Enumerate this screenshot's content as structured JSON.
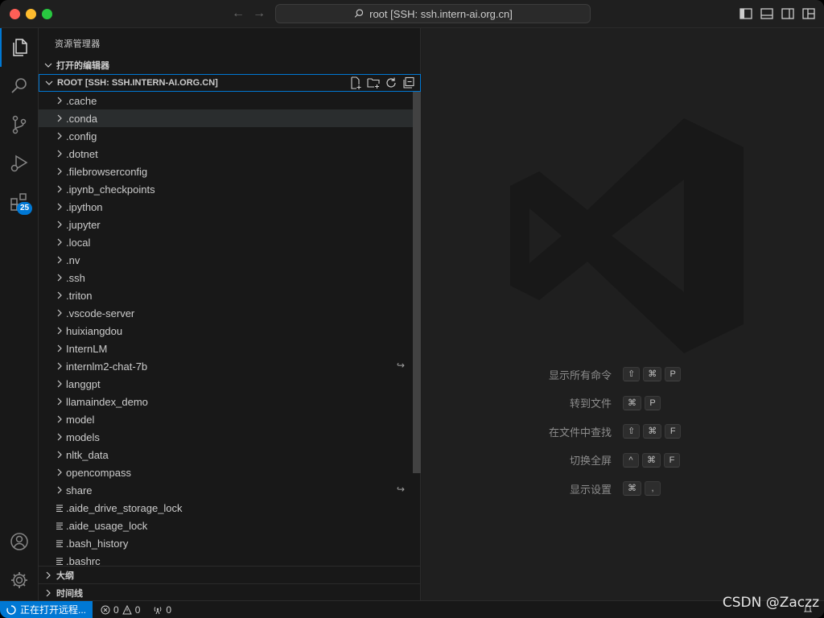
{
  "titlebar": {
    "search_text": "root [SSH: ssh.intern-ai.org.cn]"
  },
  "activitybar": {
    "items": [
      "explorer-icon",
      "search-icon",
      "source-control-icon",
      "run-debug-icon",
      "extensions-icon"
    ],
    "extensions_badge": "25",
    "bottom_items": [
      "accounts-icon",
      "manage-gear-icon"
    ]
  },
  "sidebar": {
    "title": "资源管理器",
    "open_editors_label": "打开的编辑器",
    "root_label": "ROOT [SSH: SSH.INTERN-AI.ORG.CN]",
    "outline_label": "大纲",
    "timeline_label": "时间线",
    "tree": [
      {
        "name": ".cache",
        "type": "folder"
      },
      {
        "name": ".conda",
        "type": "folder",
        "selected": true
      },
      {
        "name": ".config",
        "type": "folder"
      },
      {
        "name": ".dotnet",
        "type": "folder"
      },
      {
        "name": ".filebrowserconfig",
        "type": "folder"
      },
      {
        "name": ".ipynb_checkpoints",
        "type": "folder"
      },
      {
        "name": ".ipython",
        "type": "folder"
      },
      {
        "name": ".jupyter",
        "type": "folder"
      },
      {
        "name": ".local",
        "type": "folder"
      },
      {
        "name": ".nv",
        "type": "folder"
      },
      {
        "name": ".ssh",
        "type": "folder"
      },
      {
        "name": ".triton",
        "type": "folder"
      },
      {
        "name": ".vscode-server",
        "type": "folder"
      },
      {
        "name": "huixiangdou",
        "type": "folder"
      },
      {
        "name": "InternLM",
        "type": "folder"
      },
      {
        "name": "internlm2-chat-7b",
        "type": "folder",
        "symlink": true
      },
      {
        "name": "langgpt",
        "type": "folder"
      },
      {
        "name": "llamaindex_demo",
        "type": "folder"
      },
      {
        "name": "model",
        "type": "folder"
      },
      {
        "name": "models",
        "type": "folder"
      },
      {
        "name": "nltk_data",
        "type": "folder"
      },
      {
        "name": "opencompass",
        "type": "folder"
      },
      {
        "name": "share",
        "type": "folder",
        "symlink": true
      },
      {
        "name": ".aide_drive_storage_lock",
        "type": "file"
      },
      {
        "name": ".aide_usage_lock",
        "type": "file"
      },
      {
        "name": ".bash_history",
        "type": "file"
      },
      {
        "name": ".bashrc",
        "type": "file"
      }
    ]
  },
  "editor": {
    "shortcuts": [
      {
        "label": "显示所有命令",
        "keys": [
          "⇧",
          "⌘",
          "P"
        ]
      },
      {
        "label": "转到文件",
        "keys": [
          "⌘",
          "P"
        ]
      },
      {
        "label": "在文件中查找",
        "keys": [
          "⇧",
          "⌘",
          "F"
        ]
      },
      {
        "label": "切换全屏",
        "keys": [
          "^",
          "⌘",
          "F"
        ]
      },
      {
        "label": "显示设置",
        "keys": [
          "⌘",
          ","
        ]
      }
    ]
  },
  "statusbar": {
    "remote_label": "正在打开远程...",
    "errors": "0",
    "warnings": "0",
    "ports": "0",
    "watermark": "CSDN @Zaczz"
  }
}
